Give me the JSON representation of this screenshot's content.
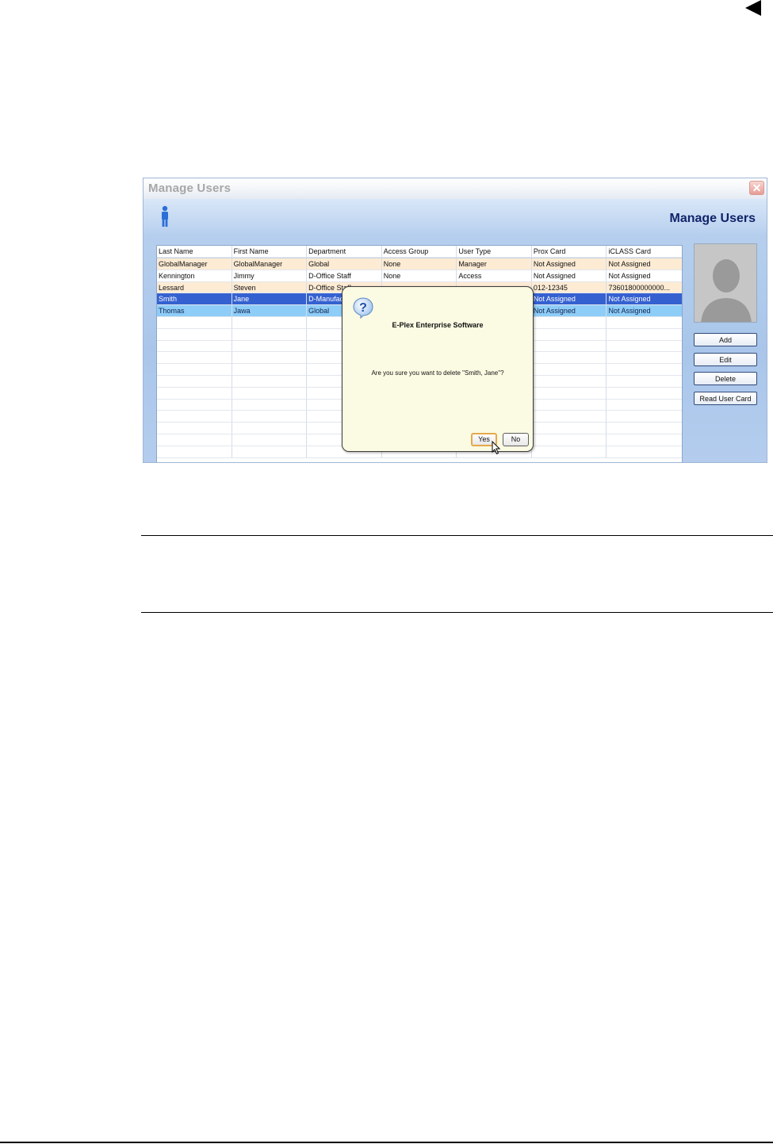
{
  "window": {
    "title": "Manage Users",
    "header_title": "Manage Users",
    "close_label": "✕"
  },
  "grid": {
    "columns": [
      "Last Name",
      "First Name",
      "Department",
      "Access Group",
      "User Type",
      "Prox Card",
      "iCLASS Card"
    ],
    "rows": [
      [
        "GlobalManager",
        "GlobalManager",
        "Global",
        "None",
        "Manager",
        "Not Assigned",
        "Not Assigned"
      ],
      [
        "Kennington",
        "Jimmy",
        "D-Office Staff",
        "None",
        "Access",
        "Not Assigned",
        "Not Assigned"
      ],
      [
        "Lessard",
        "Steven",
        "D-Office Staff",
        "",
        "",
        "012-12345",
        "73601800000000..."
      ],
      [
        "Smith",
        "Jane",
        "D-Manufac",
        "",
        "",
        "Not Assigned",
        "Not Assigned"
      ],
      [
        "Thomas",
        "Jawa",
        "Global",
        "",
        "",
        "Not Assigned",
        "Not Assigned"
      ]
    ]
  },
  "side_panel": {
    "add_label": "Add",
    "edit_label": "Edit",
    "delete_label": "Delete",
    "read_card_label": "Read User Card"
  },
  "dialog": {
    "title": "E-Plex Enterprise Software",
    "message": "Are you sure you want to delete \"Smith, Jane\"?",
    "yes_label": "Yes",
    "no_label": "No"
  },
  "colors": {
    "row_tan": "#fdebd4",
    "row_selected": "#3561d0",
    "row_selected_light": "#8ecdf7",
    "dialog_bg": "#fbfbe3",
    "header_title": "#10246a"
  }
}
